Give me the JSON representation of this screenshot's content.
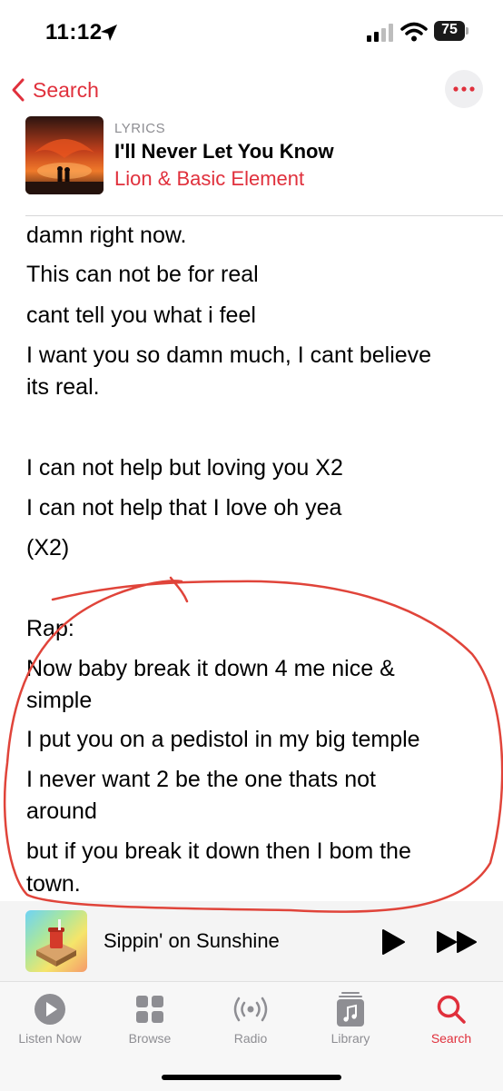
{
  "status_bar": {
    "time": "11:12",
    "battery": "75"
  },
  "nav": {
    "back_label": "Search"
  },
  "header": {
    "section_label": "LYRICS",
    "title": "I'll Never Let You Know",
    "artist": "Lion & Basic Element"
  },
  "lyrics": [
    "damn right now.",
    "This can not be for real",
    "cant tell you what i feel",
    "I want you so damn much, I cant believe",
    "its real.",
    "I can not help but loving you X2",
    "I can not help that I love oh yea",
    "(X2)",
    "Rap:",
    "Now baby break it down 4 me nice &",
    "simple",
    "I put you on a pedistol in my big temple",
    "I never want 2 be the one thats not",
    "around",
    "but if you break it down then I bom the",
    "town."
  ],
  "now_playing": {
    "title": "Sippin' on Sunshine"
  },
  "tabs": [
    {
      "label": "Listen Now",
      "icon": "play-circle-icon"
    },
    {
      "label": "Browse",
      "icon": "grid-icon"
    },
    {
      "label": "Radio",
      "icon": "radio-icon"
    },
    {
      "label": "Library",
      "icon": "library-icon"
    },
    {
      "label": "Search",
      "icon": "search-icon",
      "active": true
    }
  ],
  "colors": {
    "accent": "#e0303c",
    "annotation": "#e0443a"
  }
}
